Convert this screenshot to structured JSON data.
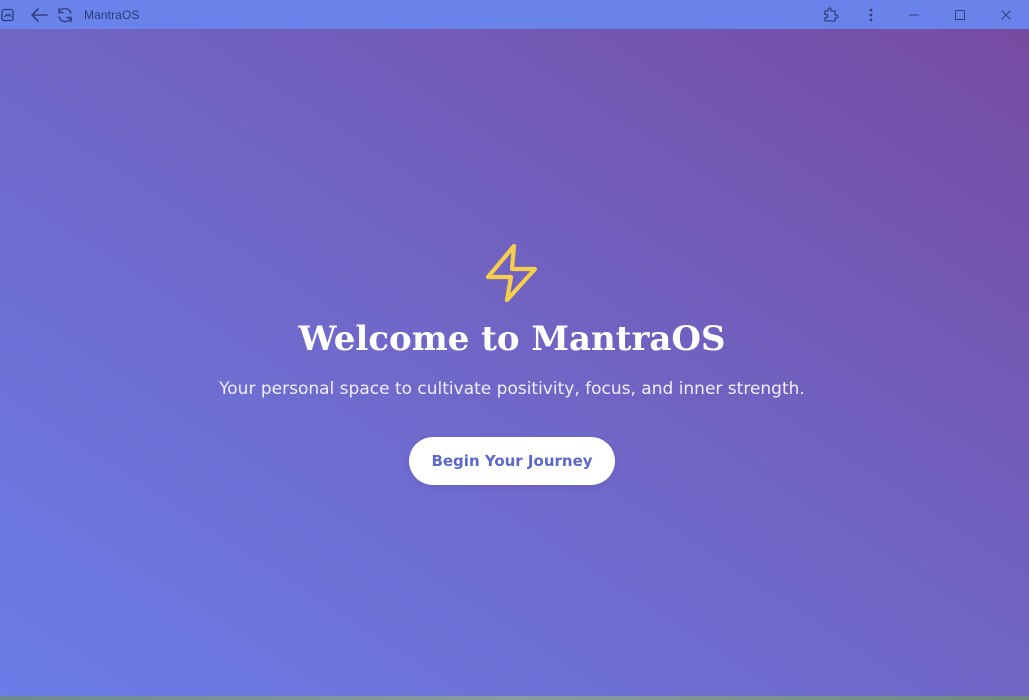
{
  "window": {
    "title": "MantraOS"
  },
  "hero": {
    "icon": "lightning-bolt-icon",
    "heading": "Welcome to MantraOS",
    "subtitle": "Your personal space to cultivate positivity, focus, and inner strength.",
    "cta_label": "Begin Your Journey"
  },
  "colors": {
    "titlebar": "#6a83eb",
    "gradient_start": "#6a7de8",
    "gradient_end": "#764ba2",
    "bolt": "#f5cf4b",
    "cta_text": "#5b68c9"
  }
}
